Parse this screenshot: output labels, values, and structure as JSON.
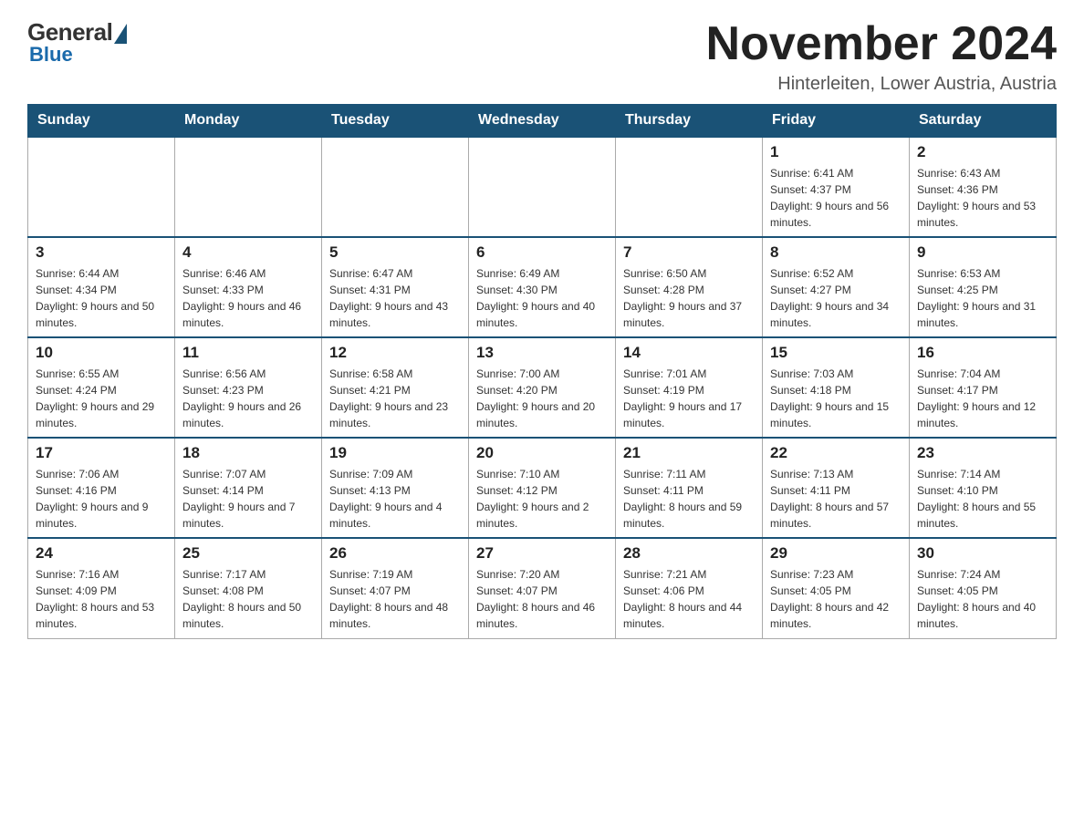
{
  "logo": {
    "general": "General",
    "blue": "Blue"
  },
  "title": {
    "month": "November 2024",
    "location": "Hinterleiten, Lower Austria, Austria"
  },
  "weekdays": [
    "Sunday",
    "Monday",
    "Tuesday",
    "Wednesday",
    "Thursday",
    "Friday",
    "Saturday"
  ],
  "weeks": [
    [
      {
        "day": "",
        "info": ""
      },
      {
        "day": "",
        "info": ""
      },
      {
        "day": "",
        "info": ""
      },
      {
        "day": "",
        "info": ""
      },
      {
        "day": "",
        "info": ""
      },
      {
        "day": "1",
        "info": "Sunrise: 6:41 AM\nSunset: 4:37 PM\nDaylight: 9 hours and 56 minutes."
      },
      {
        "day": "2",
        "info": "Sunrise: 6:43 AM\nSunset: 4:36 PM\nDaylight: 9 hours and 53 minutes."
      }
    ],
    [
      {
        "day": "3",
        "info": "Sunrise: 6:44 AM\nSunset: 4:34 PM\nDaylight: 9 hours and 50 minutes."
      },
      {
        "day": "4",
        "info": "Sunrise: 6:46 AM\nSunset: 4:33 PM\nDaylight: 9 hours and 46 minutes."
      },
      {
        "day": "5",
        "info": "Sunrise: 6:47 AM\nSunset: 4:31 PM\nDaylight: 9 hours and 43 minutes."
      },
      {
        "day": "6",
        "info": "Sunrise: 6:49 AM\nSunset: 4:30 PM\nDaylight: 9 hours and 40 minutes."
      },
      {
        "day": "7",
        "info": "Sunrise: 6:50 AM\nSunset: 4:28 PM\nDaylight: 9 hours and 37 minutes."
      },
      {
        "day": "8",
        "info": "Sunrise: 6:52 AM\nSunset: 4:27 PM\nDaylight: 9 hours and 34 minutes."
      },
      {
        "day": "9",
        "info": "Sunrise: 6:53 AM\nSunset: 4:25 PM\nDaylight: 9 hours and 31 minutes."
      }
    ],
    [
      {
        "day": "10",
        "info": "Sunrise: 6:55 AM\nSunset: 4:24 PM\nDaylight: 9 hours and 29 minutes."
      },
      {
        "day": "11",
        "info": "Sunrise: 6:56 AM\nSunset: 4:23 PM\nDaylight: 9 hours and 26 minutes."
      },
      {
        "day": "12",
        "info": "Sunrise: 6:58 AM\nSunset: 4:21 PM\nDaylight: 9 hours and 23 minutes."
      },
      {
        "day": "13",
        "info": "Sunrise: 7:00 AM\nSunset: 4:20 PM\nDaylight: 9 hours and 20 minutes."
      },
      {
        "day": "14",
        "info": "Sunrise: 7:01 AM\nSunset: 4:19 PM\nDaylight: 9 hours and 17 minutes."
      },
      {
        "day": "15",
        "info": "Sunrise: 7:03 AM\nSunset: 4:18 PM\nDaylight: 9 hours and 15 minutes."
      },
      {
        "day": "16",
        "info": "Sunrise: 7:04 AM\nSunset: 4:17 PM\nDaylight: 9 hours and 12 minutes."
      }
    ],
    [
      {
        "day": "17",
        "info": "Sunrise: 7:06 AM\nSunset: 4:16 PM\nDaylight: 9 hours and 9 minutes."
      },
      {
        "day": "18",
        "info": "Sunrise: 7:07 AM\nSunset: 4:14 PM\nDaylight: 9 hours and 7 minutes."
      },
      {
        "day": "19",
        "info": "Sunrise: 7:09 AM\nSunset: 4:13 PM\nDaylight: 9 hours and 4 minutes."
      },
      {
        "day": "20",
        "info": "Sunrise: 7:10 AM\nSunset: 4:12 PM\nDaylight: 9 hours and 2 minutes."
      },
      {
        "day": "21",
        "info": "Sunrise: 7:11 AM\nSunset: 4:11 PM\nDaylight: 8 hours and 59 minutes."
      },
      {
        "day": "22",
        "info": "Sunrise: 7:13 AM\nSunset: 4:11 PM\nDaylight: 8 hours and 57 minutes."
      },
      {
        "day": "23",
        "info": "Sunrise: 7:14 AM\nSunset: 4:10 PM\nDaylight: 8 hours and 55 minutes."
      }
    ],
    [
      {
        "day": "24",
        "info": "Sunrise: 7:16 AM\nSunset: 4:09 PM\nDaylight: 8 hours and 53 minutes."
      },
      {
        "day": "25",
        "info": "Sunrise: 7:17 AM\nSunset: 4:08 PM\nDaylight: 8 hours and 50 minutes."
      },
      {
        "day": "26",
        "info": "Sunrise: 7:19 AM\nSunset: 4:07 PM\nDaylight: 8 hours and 48 minutes."
      },
      {
        "day": "27",
        "info": "Sunrise: 7:20 AM\nSunset: 4:07 PM\nDaylight: 8 hours and 46 minutes."
      },
      {
        "day": "28",
        "info": "Sunrise: 7:21 AM\nSunset: 4:06 PM\nDaylight: 8 hours and 44 minutes."
      },
      {
        "day": "29",
        "info": "Sunrise: 7:23 AM\nSunset: 4:05 PM\nDaylight: 8 hours and 42 minutes."
      },
      {
        "day": "30",
        "info": "Sunrise: 7:24 AM\nSunset: 4:05 PM\nDaylight: 8 hours and 40 minutes."
      }
    ]
  ]
}
